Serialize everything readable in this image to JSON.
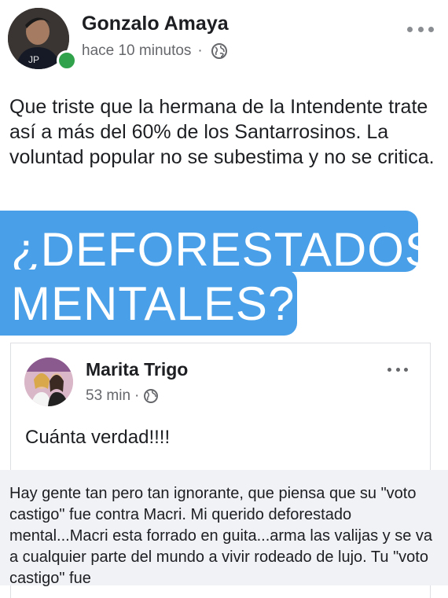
{
  "post": {
    "author": "Gonzalo Amaya",
    "time": "hace 10 minutos",
    "separator": "·",
    "privacy_icon": "globe-icon",
    "more_icon": "more-dots-icon",
    "status": "online",
    "text": "Que triste que la hermana de la Intendente trate así a más del 60% de los Santarrosinos. La voluntad popular no se subestima y no se critica."
  },
  "image": {
    "headline_line1": "¿DEFORESTADOS",
    "headline_line2": "MENTALES?",
    "headline_bg": "#4aa0e8",
    "embedded_post": {
      "author": "Marita Trigo",
      "time": "53 min",
      "separator": "·",
      "text": "Cuánta verdad!!!!"
    },
    "comment_text": "Hay gente tan pero tan ignorante, que piensa que su \"voto castigo\" fue contra Macri. Mi querido deforestado mental...Macri esta forrado en guita...arma las valijas y se va a cualquier parte del mundo a vivir rodeado de lujo. Tu \"voto castigo\" fue"
  }
}
